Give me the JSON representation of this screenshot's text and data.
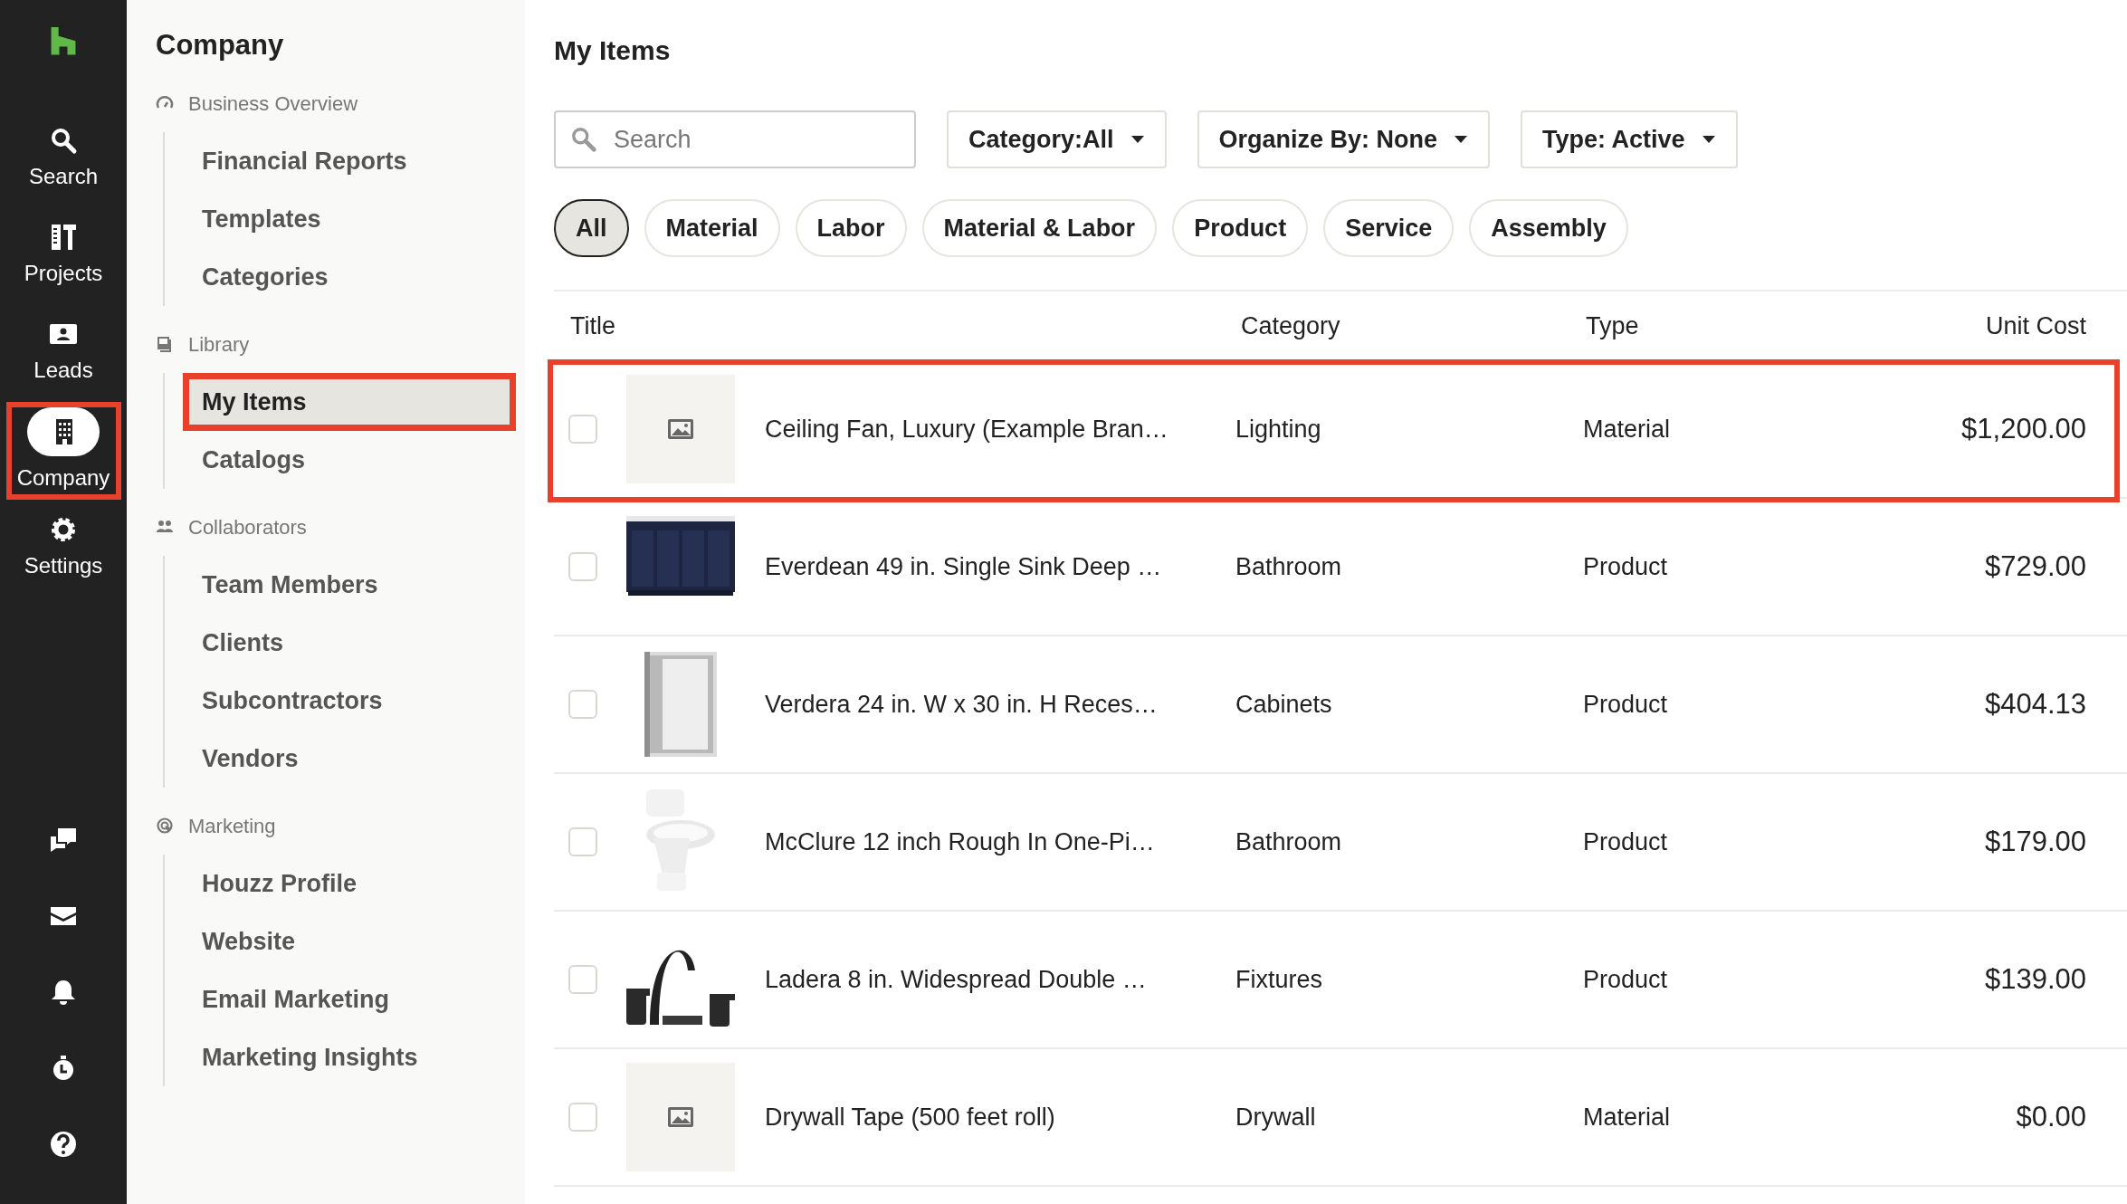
{
  "rail": {
    "items": [
      {
        "label": "Search",
        "selected": false,
        "highlighted": false
      },
      {
        "label": "Projects",
        "selected": false,
        "highlighted": false
      },
      {
        "label": "Leads",
        "selected": false,
        "highlighted": false
      },
      {
        "label": "Company",
        "selected": true,
        "highlighted": true
      },
      {
        "label": "Settings",
        "selected": false,
        "highlighted": false
      }
    ]
  },
  "sidebar": {
    "title": "Company",
    "sections": [
      {
        "label": "Business Overview",
        "children": [
          {
            "label": "Financial Reports",
            "selected": false,
            "highlighted": false
          },
          {
            "label": "Templates",
            "selected": false,
            "highlighted": false
          },
          {
            "label": "Categories",
            "selected": false,
            "highlighted": false
          }
        ]
      },
      {
        "label": "Library",
        "children": [
          {
            "label": "My Items",
            "selected": true,
            "highlighted": true
          },
          {
            "label": "Catalogs",
            "selected": false,
            "highlighted": false
          }
        ]
      },
      {
        "label": "Collaborators",
        "children": [
          {
            "label": "Team Members",
            "selected": false,
            "highlighted": false
          },
          {
            "label": "Clients",
            "selected": false,
            "highlighted": false
          },
          {
            "label": "Subcontractors",
            "selected": false,
            "highlighted": false
          },
          {
            "label": "Vendors",
            "selected": false,
            "highlighted": false
          }
        ]
      },
      {
        "label": "Marketing",
        "children": [
          {
            "label": "Houzz Profile",
            "selected": false,
            "highlighted": false
          },
          {
            "label": "Website",
            "selected": false,
            "highlighted": false
          },
          {
            "label": "Email Marketing",
            "selected": false,
            "highlighted": false
          },
          {
            "label": "Marketing Insights",
            "selected": false,
            "highlighted": false
          }
        ]
      }
    ]
  },
  "main": {
    "title": "My Items",
    "search": {
      "placeholder": "Search"
    },
    "filters": [
      {
        "label": "Category:All"
      },
      {
        "label": "Organize By: None"
      },
      {
        "label": "Type: Active"
      }
    ],
    "chips": [
      {
        "label": "All",
        "selected": true
      },
      {
        "label": "Material",
        "selected": false
      },
      {
        "label": "Labor",
        "selected": false
      },
      {
        "label": "Material & Labor",
        "selected": false
      },
      {
        "label": "Product",
        "selected": false
      },
      {
        "label": "Service",
        "selected": false
      },
      {
        "label": "Assembly",
        "selected": false
      }
    ],
    "table": {
      "columns": [
        "Title",
        "Category",
        "Type",
        "Unit Cost"
      ],
      "rows": [
        {
          "checked": false,
          "highlighted": true,
          "thumbnail": {
            "kind": "placeholder"
          },
          "title": "Ceiling Fan, Luxury (Example Bran…",
          "category": "Lighting",
          "type": "Material",
          "unit_cost": "$1,200.00"
        },
        {
          "checked": false,
          "highlighted": false,
          "title": "Everdean 49 in. Single Sink Deep …",
          "category": "Bathroom",
          "type": "Product",
          "unit_cost": "$729.00"
        },
        {
          "checked": false,
          "highlighted": false,
          "title": "Verdera 24 in. W x 30 in. H Reces…",
          "category": "Cabinets",
          "type": "Product",
          "unit_cost": "$404.13"
        },
        {
          "checked": false,
          "highlighted": false,
          "title": "McClure 12 inch Rough In One-Pi…",
          "category": "Bathroom",
          "type": "Product",
          "unit_cost": "$179.00"
        },
        {
          "checked": false,
          "highlighted": false,
          "title": "Ladera 8 in. Widespread Double …",
          "category": "Fixtures",
          "type": "Product",
          "unit_cost": "$139.00"
        },
        {
          "checked": false,
          "highlighted": false,
          "thumbnail": {
            "kind": "placeholder"
          },
          "title": "Drywall Tape (500 feet roll)",
          "category": "Drywall",
          "type": "Material",
          "unit_cost": "$0.00"
        }
      ]
    }
  }
}
